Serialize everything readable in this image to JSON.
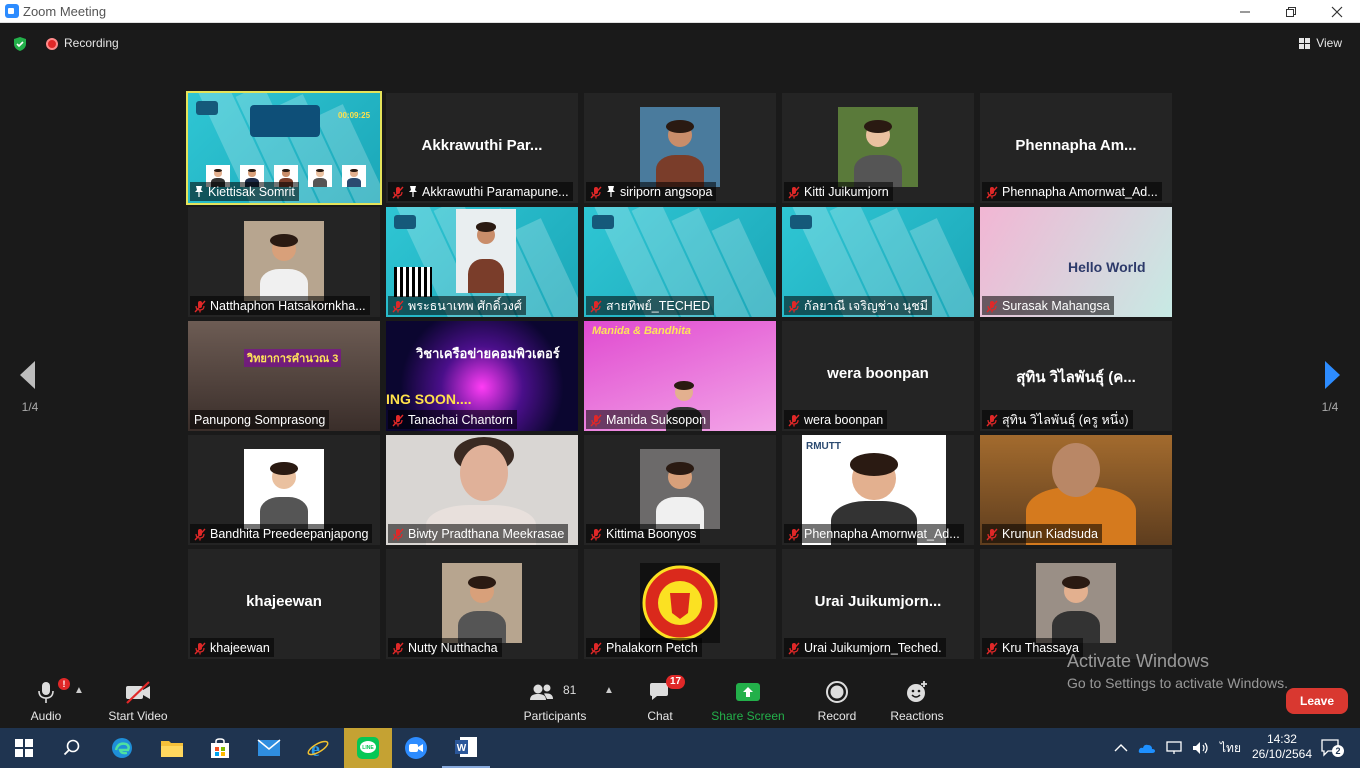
{
  "window": {
    "title": "Zoom Meeting"
  },
  "topbar": {
    "recording_label": "Recording",
    "view_label": "View"
  },
  "pager": {
    "indicator_left": "1/4",
    "indicator_right": "1/4"
  },
  "tiles": [
    {
      "label": "Kiettisak Somrit",
      "big_name": "",
      "muted": false,
      "pinned": true,
      "active": true,
      "kind": "obs-poster",
      "poster_timer": "00:09:25"
    },
    {
      "label": "Akkrawuthi Paramapune...",
      "big_name": "Akkrawuthi  Par...",
      "muted": true,
      "pinned": true,
      "kind": "name"
    },
    {
      "label": "siriporn angsopa",
      "big_name": "",
      "muted": true,
      "pinned": true,
      "kind": "photo"
    },
    {
      "label": "Kitti Juikumjorn",
      "big_name": "",
      "muted": true,
      "kind": "photo"
    },
    {
      "label": "Phennapha Amornwat_Ad...",
      "big_name": "Phennapha  Am...",
      "muted": true,
      "kind": "name"
    },
    {
      "label": "Natthaphon Hatsakornkha...",
      "big_name": "",
      "muted": true,
      "kind": "photo"
    },
    {
      "label": "พระธนาเทพ ศักดิ์วงศ์",
      "big_name": "",
      "muted": true,
      "kind": "obs-photo"
    },
    {
      "label": "สายทิพย์_TECHED",
      "big_name": "",
      "muted": true,
      "kind": "obs"
    },
    {
      "label": "กัลยาณี เจริญช่าง นุชมี",
      "big_name": "",
      "muted": true,
      "kind": "obs"
    },
    {
      "label": "Surasak Mahangsa",
      "big_name": "",
      "muted": true,
      "kind": "hello",
      "slide_text": "Hello World"
    },
    {
      "label": "Panupong Somprasong",
      "big_name": "",
      "muted": false,
      "kind": "room",
      "slide_text": "วิทยาการคำนวณ 3"
    },
    {
      "label": "Tanachai Chantorn",
      "big_name": "",
      "muted": true,
      "kind": "neon",
      "slide_text": "วิชาเครือข่ายคอมพิวเตอร์",
      "slide_sub": "ING SOON...."
    },
    {
      "label": "Manida Suksopon",
      "big_name": "",
      "muted": true,
      "kind": "manida",
      "slide_text": "Manida & Bandhita"
    },
    {
      "label": "wera boonpan",
      "big_name": "wera boonpan",
      "muted": true,
      "kind": "name"
    },
    {
      "label": "สุทิน วิไลพันธุ์ (ครู หนึ่ง)",
      "big_name": "สุทิน วิไลพันธุ์ (ค...",
      "muted": true,
      "kind": "name"
    },
    {
      "label": "Bandhita Preedeepanjapong",
      "big_name": "",
      "muted": true,
      "kind": "photo"
    },
    {
      "label": "Biwty Pradthana Meekrasae",
      "big_name": "",
      "muted": true,
      "kind": "webcam"
    },
    {
      "label": "Kittima Boonyos",
      "big_name": "",
      "muted": true,
      "kind": "photo"
    },
    {
      "label": "Phennapha Amornwat_Ad...",
      "big_name": "",
      "muted": true,
      "kind": "rmutt",
      "slide_text": "RMUTT"
    },
    {
      "label": "Krunun Kiadsuda",
      "big_name": "",
      "muted": true,
      "kind": "monk"
    },
    {
      "label": "khajeewan",
      "big_name": "khajeewan",
      "muted": true,
      "kind": "name"
    },
    {
      "label": "Nutty Nutthacha",
      "big_name": "",
      "muted": true,
      "kind": "photo"
    },
    {
      "label": "Phalakorn Petch",
      "big_name": "",
      "muted": true,
      "kind": "crest",
      "slide_text": "MANCHESTER UNITED"
    },
    {
      "label": "Urai Juikumjorn_Teched.",
      "big_name": "Urai  Juikumjorn...",
      "muted": true,
      "kind": "name"
    },
    {
      "label": "Kru Thassaya",
      "big_name": "",
      "muted": true,
      "kind": "photo"
    }
  ],
  "toolbar": {
    "audio_label": "Audio",
    "audio_badge": "!",
    "video_label": "Start Video",
    "participants_label": "Participants",
    "participants_count": "81",
    "chat_label": "Chat",
    "chat_badge": "17",
    "share_label": "Share Screen",
    "record_label": "Record",
    "reactions_label": "Reactions",
    "leave_label": "Leave"
  },
  "watermark": {
    "line1": "Activate Windows",
    "line2": "Go to Settings to activate Windows."
  },
  "taskbar": {
    "language": "ไทย",
    "time": "14:32",
    "date": "26/10/2564",
    "notifications": "2",
    "line_label": "LINE"
  },
  "colors": {
    "active_speaker": "#e5e35a",
    "share_green": "#23b04a",
    "leave_red": "#d93830",
    "muted_red": "#e02828"
  }
}
